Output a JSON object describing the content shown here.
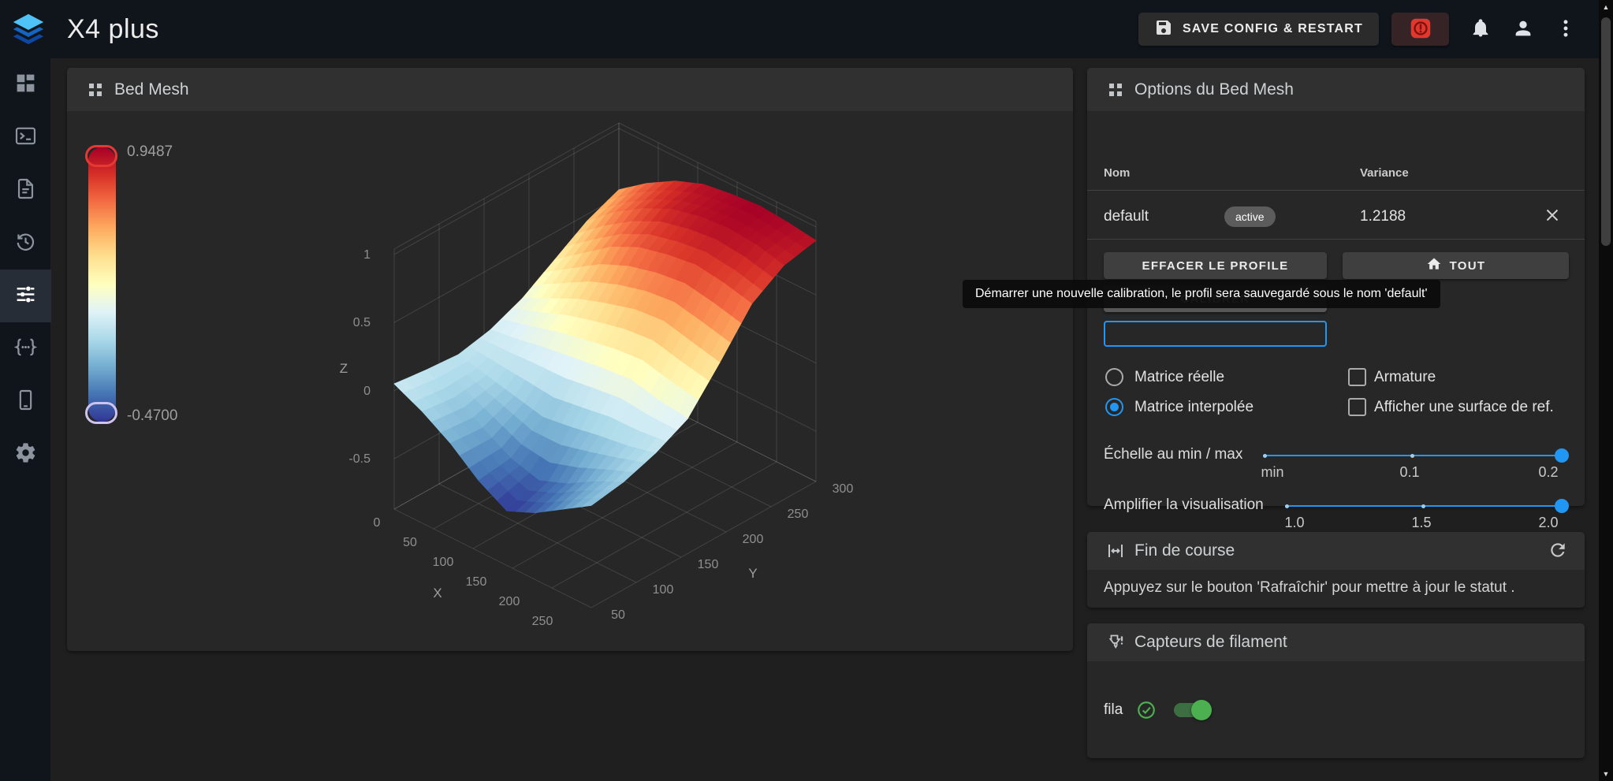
{
  "toolbar": {
    "title": "X4 plus",
    "save_button": "SAVE CONFIG & RESTART"
  },
  "bed_mesh": {
    "title": "Bed Mesh",
    "colorbar": {
      "max": "0.9487",
      "min": "-0.4700"
    }
  },
  "chart_data": {
    "type": "heatmap",
    "title": "Bed Mesh",
    "xlabel": "X",
    "ylabel": "Y",
    "zlabel": "Z",
    "x_ticks": [
      0,
      50,
      100,
      150,
      200,
      250
    ],
    "y_ticks": [
      50,
      100,
      150,
      200,
      250,
      300
    ],
    "z_ticks": [
      -0.5,
      0,
      0.5,
      1
    ],
    "z_range": [
      -0.47,
      0.9487
    ],
    "colorscale": [
      "#313695",
      "#4575b4",
      "#74add1",
      "#abd9e9",
      "#e0f3f8",
      "#ffffbf",
      "#fee090",
      "#fdae61",
      "#f46d43",
      "#d73027",
      "#a50026"
    ],
    "surface_z": [
      [
        0.05,
        -0.05,
        -0.18,
        -0.35,
        -0.47,
        -0.38,
        -0.25,
        -0.12
      ],
      [
        0.02,
        -0.08,
        -0.2,
        -0.32,
        -0.38,
        -0.3,
        -0.18,
        -0.08
      ],
      [
        0.0,
        -0.05,
        -0.1,
        -0.15,
        -0.12,
        -0.08,
        -0.05,
        0.0
      ],
      [
        0.05,
        0.08,
        0.12,
        0.15,
        0.18,
        0.2,
        0.15,
        0.12
      ],
      [
        0.15,
        0.25,
        0.35,
        0.42,
        0.48,
        0.5,
        0.45,
        0.4
      ],
      [
        0.3,
        0.45,
        0.6,
        0.7,
        0.75,
        0.78,
        0.75,
        0.7
      ],
      [
        0.45,
        0.62,
        0.75,
        0.85,
        0.9,
        0.92,
        0.9,
        0.85
      ],
      [
        0.55,
        0.7,
        0.82,
        0.9,
        0.93,
        0.9487,
        0.93,
        0.9
      ]
    ]
  },
  "options": {
    "title": "Options du Bed Mesh",
    "table": {
      "headers": [
        "Nom",
        "Variance"
      ],
      "rows": [
        {
          "name": "default",
          "badge": "active",
          "variance": "1.2188"
        }
      ]
    },
    "buttons": {
      "clear": "EFFACER LE PROFILE",
      "all": "TOUT",
      "calibrate": "CALIBRER"
    },
    "tooltip": "Démarrer une nouvelle calibration, le profil sera sauvegardé sous le nom 'default'",
    "radios": [
      {
        "label": "Matrice réelle",
        "checked": false
      },
      {
        "label": "Matrice interpolée",
        "checked": true
      }
    ],
    "checkboxes": [
      {
        "label": "Armature",
        "checked": false
      },
      {
        "label": "Afficher une surface de ref.",
        "checked": false
      }
    ],
    "sliders": [
      {
        "label": "Échelle au min / max",
        "ticks": [
          "min",
          "0.1",
          "0.2"
        ],
        "value": "0.2"
      },
      {
        "label": "Amplifier la visualisation",
        "ticks": [
          "1.0",
          "1.5",
          "2.0"
        ],
        "value": "2.0"
      }
    ]
  },
  "endstops": {
    "title": "Fin de course",
    "message": "Appuyez sur le bouton 'Rafraîchir' pour mettre à jour le statut ."
  },
  "filament": {
    "title": "Capteurs de filament",
    "sensor_name": "fila",
    "state": "on"
  },
  "colors": {
    "accent": "#2196f3",
    "success": "#4caf50",
    "danger": "#e53935"
  }
}
